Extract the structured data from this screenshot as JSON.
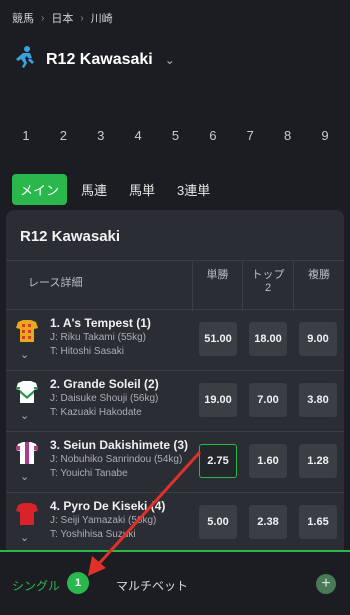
{
  "breadcrumb": {
    "items": [
      "競馬",
      "日本",
      "川崎"
    ],
    "separator": "›"
  },
  "race": {
    "title": "R12 Kawasaki",
    "icon": "horse-jockey-icon"
  },
  "race_numbers": [
    "1",
    "2",
    "3",
    "4",
    "5",
    "6",
    "7",
    "8",
    "9"
  ],
  "tabs": [
    "メイン",
    "馬連",
    "馬単",
    "3連単"
  ],
  "card": {
    "title": "R12 Kawasaki",
    "headers": {
      "detail": "レース詳細",
      "win": "単勝",
      "top2_line1": "トップ",
      "top2_line2": "2",
      "place": "複勝"
    }
  },
  "runners": [
    {
      "name": "1. A's Tempest (1)",
      "jockey": "J: Riku Takami (55kg)",
      "trainer": "T: Hitoshi Sasaki",
      "odds": [
        "51.00",
        "18.00",
        "9.00"
      ],
      "silk_colors": [
        "#e8a820",
        "#d93a2a"
      ],
      "selected": false
    },
    {
      "name": "2. Grande Soleil (2)",
      "jockey": "J: Daisuke Shouji (56kg)",
      "trainer": "T: Kazuaki Hakodate",
      "odds": [
        "19.00",
        "7.00",
        "3.80"
      ],
      "silk_colors": [
        "#ffffff",
        "#2a9a4a"
      ],
      "selected": false
    },
    {
      "name": "3. Seiun Dakishimete (3)",
      "jockey": "J: Nobuhiko Sanrindou (54kg)",
      "trainer": "T: Youichi Tanabe",
      "odds": [
        "2.75",
        "1.60",
        "1.28"
      ],
      "silk_colors": [
        "#ffffff",
        "#b23a8a"
      ],
      "selected": true
    },
    {
      "name": "4. Pyro De Kiseki (4)",
      "jockey": "J: Seiji Yamazaki (56kg)",
      "trainer": "T: Yoshihisa Suzuki",
      "odds": [
        "5.00",
        "2.38",
        "1.65"
      ],
      "silk_colors": [
        "#d8232a",
        "#d8232a"
      ],
      "selected": false
    }
  ],
  "betslip": {
    "single_label": "シングル",
    "count": "1",
    "multi_label": "マルチベット",
    "add_icon": "plus-icon"
  },
  "colors": {
    "accent": "#2ab84c",
    "annotation_arrow": "#e0302a"
  }
}
